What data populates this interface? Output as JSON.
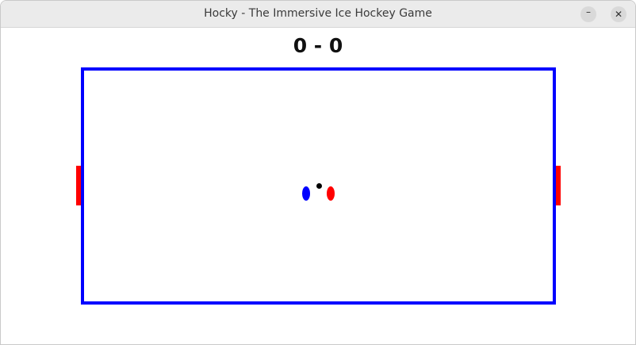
{
  "window": {
    "title": "Hocky - The Immersive Ice Hockey Game",
    "minimize_glyph": "–",
    "close_glyph": "✕"
  },
  "game": {
    "score": "0 - 0",
    "colors": {
      "rink_border": "#0000ff",
      "goals": "#ff0000",
      "player_blue": "#0000ff",
      "player_red": "#ff0000",
      "puck": "#000000"
    }
  }
}
